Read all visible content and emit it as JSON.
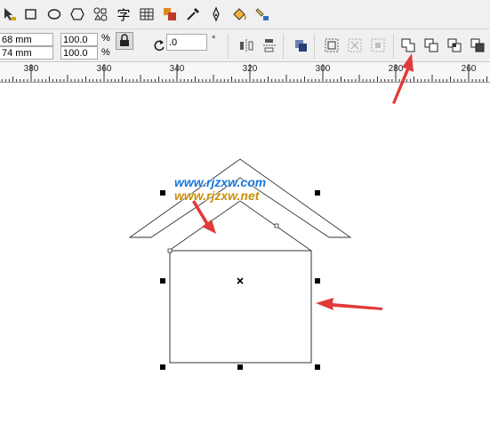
{
  "toolbar": {
    "icons": [
      "pick-tool",
      "rectangle-tool",
      "ellipse-tool",
      "polygon-tool",
      "shapes-tool",
      "text-tool",
      "table-tool",
      "transform-tool",
      "eyedropper-tool",
      "outline-pen-tool",
      "fill-tool",
      "interactive-fill-tool"
    ],
    "text_tool_label": "字"
  },
  "property_bar": {
    "width_value": "68 mm",
    "height_value": "74 mm",
    "scale_x": "100.0",
    "scale_y": "100.0",
    "percent_symbol": "%",
    "rotation_value": ".0",
    "degree_symbol": "°"
  },
  "ruler": {
    "labels": [
      "380",
      "360",
      "340",
      "320",
      "300",
      "280",
      "260"
    ]
  },
  "watermark": {
    "line1": "www.rjzxw.com",
    "line2": "www.rjzxw.net"
  },
  "colors": {
    "accent_arrow": "#e03a3a",
    "watermark_blue": "#1a78d8",
    "watermark_gold": "#c8900a"
  }
}
